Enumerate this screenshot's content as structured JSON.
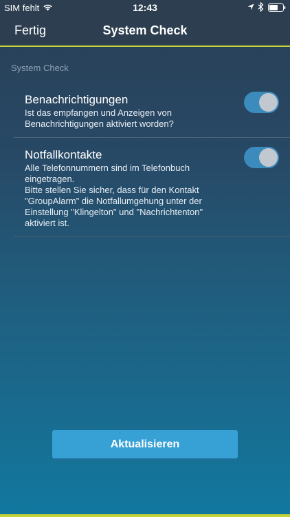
{
  "status_bar": {
    "carrier": "SIM fehlt",
    "time": "12:43"
  },
  "nav": {
    "done_label": "Fertig",
    "title": "System Check"
  },
  "section": {
    "header": "System Check"
  },
  "rows": [
    {
      "title": "Benachrichtigungen",
      "description": "Ist das empfangen und Anzeigen von\nBenachrichtigungen aktiviert worden?",
      "enabled": true
    },
    {
      "title": "Notfallkontakte",
      "description": "Alle Telefonnummern sind im Telefonbuch\neingetragen.\nBitte stellen Sie sicher, dass für den Kontakt\n\"GroupAlarm\" die Notfallumgehung unter der\nEinstellung \"Klingelton\" und \"Nachrichtenton\"\naktiviert ist.",
      "enabled": true
    }
  ],
  "actions": {
    "refresh_label": "Aktualisieren"
  },
  "colors": {
    "accent": "#c6d23a",
    "button": "#37a1d6",
    "toggle_on": "#3c8bbd",
    "nav_bg": "#2d3e50"
  },
  "icons": [
    "wifi-icon",
    "location-icon",
    "bluetooth-icon",
    "battery-icon"
  ]
}
